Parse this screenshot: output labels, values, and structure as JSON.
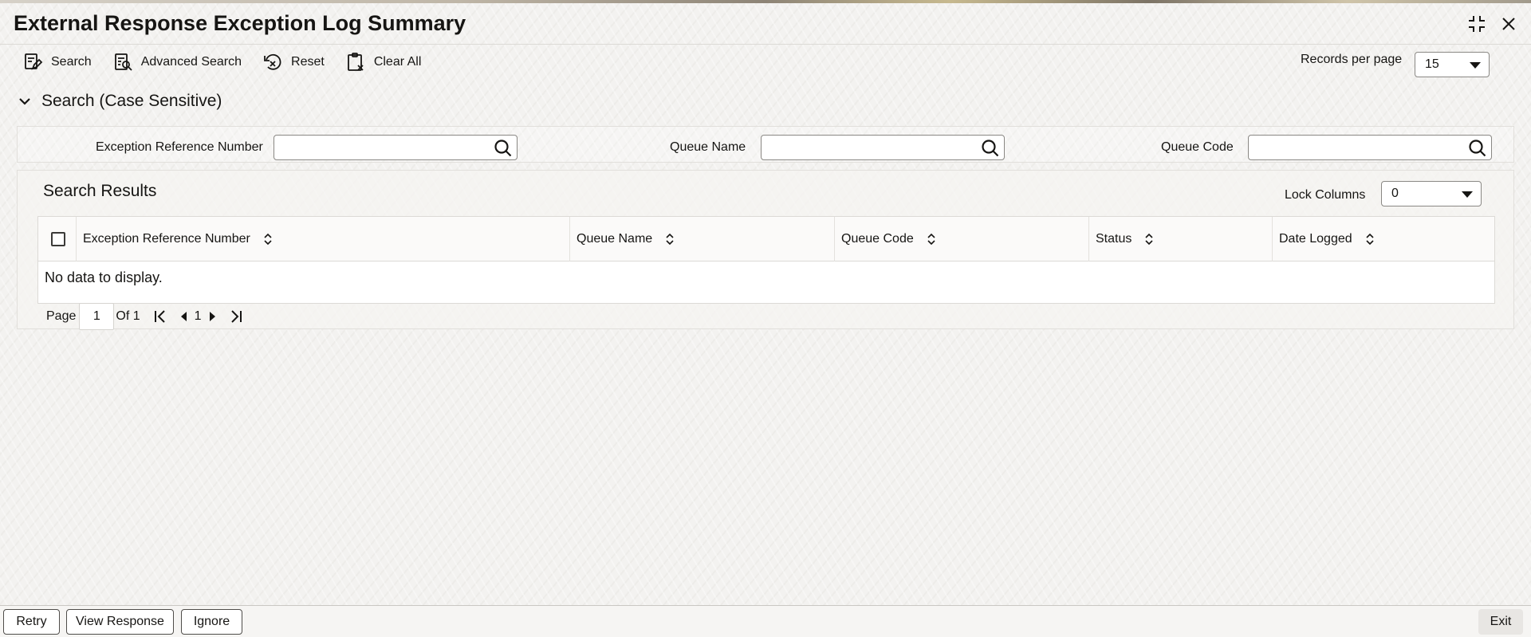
{
  "title": "External Response Exception Log Summary",
  "toolbar": {
    "search": "Search",
    "advanced_search": "Advanced Search",
    "reset": "Reset",
    "clear_all": "Clear All"
  },
  "records_per_page": {
    "label": "Records per page",
    "value": "15"
  },
  "search_section": {
    "title": "Search (Case Sensitive)"
  },
  "criteria": {
    "exception_ref_label": "Exception Reference Number",
    "exception_ref_value": "",
    "queue_name_label": "Queue Name",
    "queue_name_value": "",
    "queue_code_label": "Queue Code",
    "queue_code_value": ""
  },
  "results": {
    "title": "Search Results",
    "lock_columns_label": "Lock Columns",
    "lock_columns_value": "0",
    "columns": [
      "Exception Reference Number",
      "Queue Name",
      "Queue Code",
      "Status",
      "Date Logged"
    ],
    "empty_message": "No data to display."
  },
  "pagination": {
    "page_label": "Page",
    "current_page": "1",
    "of_label": "Of 1",
    "page_number": "1"
  },
  "footer": {
    "retry": "Retry",
    "view_response": "View Response",
    "ignore": "Ignore",
    "exit": "Exit"
  },
  "icons": {
    "maximize": "maximize-icon",
    "close": "close-icon",
    "search": "search-icon",
    "advanced_search": "advanced-search-icon",
    "reset": "reset-icon",
    "clear_all": "clear-all-icon",
    "collapse": "chevron-down-icon",
    "magnifier": "magnifier-icon",
    "sort": "sort-icon",
    "first_page": "first-page-icon",
    "prev_page": "prev-page-icon",
    "next_page": "next-page-icon",
    "last_page": "last-page-icon"
  }
}
